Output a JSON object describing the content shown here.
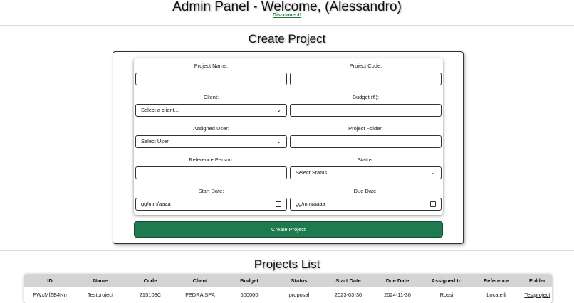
{
  "header": {
    "title": "Admin Panel - Welcome, (Alessandro)",
    "disconnect_label": "Disconnect!"
  },
  "create_project": {
    "title": "Create Project",
    "fields": {
      "project_name": {
        "label": "Project Name:",
        "value": ""
      },
      "project_code": {
        "label": "Project Code:",
        "value": ""
      },
      "client": {
        "label": "Client:",
        "selected": "Select a client..."
      },
      "budget": {
        "label": "Budget (€):",
        "value": ""
      },
      "assigned_user": {
        "label": "Assigned User:",
        "selected": "Select User"
      },
      "project_folder": {
        "label": "Project Folder:",
        "value": ""
      },
      "reference_person": {
        "label": "Reference Person:",
        "value": ""
      },
      "status": {
        "label": "Status:",
        "selected": "Select Status"
      },
      "start_date": {
        "label": "Start Date:",
        "value": "gg/mm/aaaa"
      },
      "due_date": {
        "label": "Due Date:",
        "value": "gg/mm/aaaa"
      }
    },
    "submit_label": "Create Project"
  },
  "projects_list": {
    "title": "Projects List",
    "columns": [
      "ID",
      "Name",
      "Code",
      "Client",
      "Budget",
      "Status",
      "Start Date",
      "Due Date",
      "Assigned to",
      "Reference",
      "Folder"
    ],
    "rows": [
      [
        "PWxMfZB4Nn",
        "Testproject",
        "215103C",
        "FEDRA SPA",
        "500000",
        "proposal",
        "2023-03-30",
        "2024-11-30",
        "Rossi",
        "Locatelli",
        "Testproject"
      ]
    ]
  },
  "colors": {
    "accent_green": "#1e7a4f",
    "link_green": "#1a7a3a",
    "table_header_bg": "#d4d4d4"
  }
}
